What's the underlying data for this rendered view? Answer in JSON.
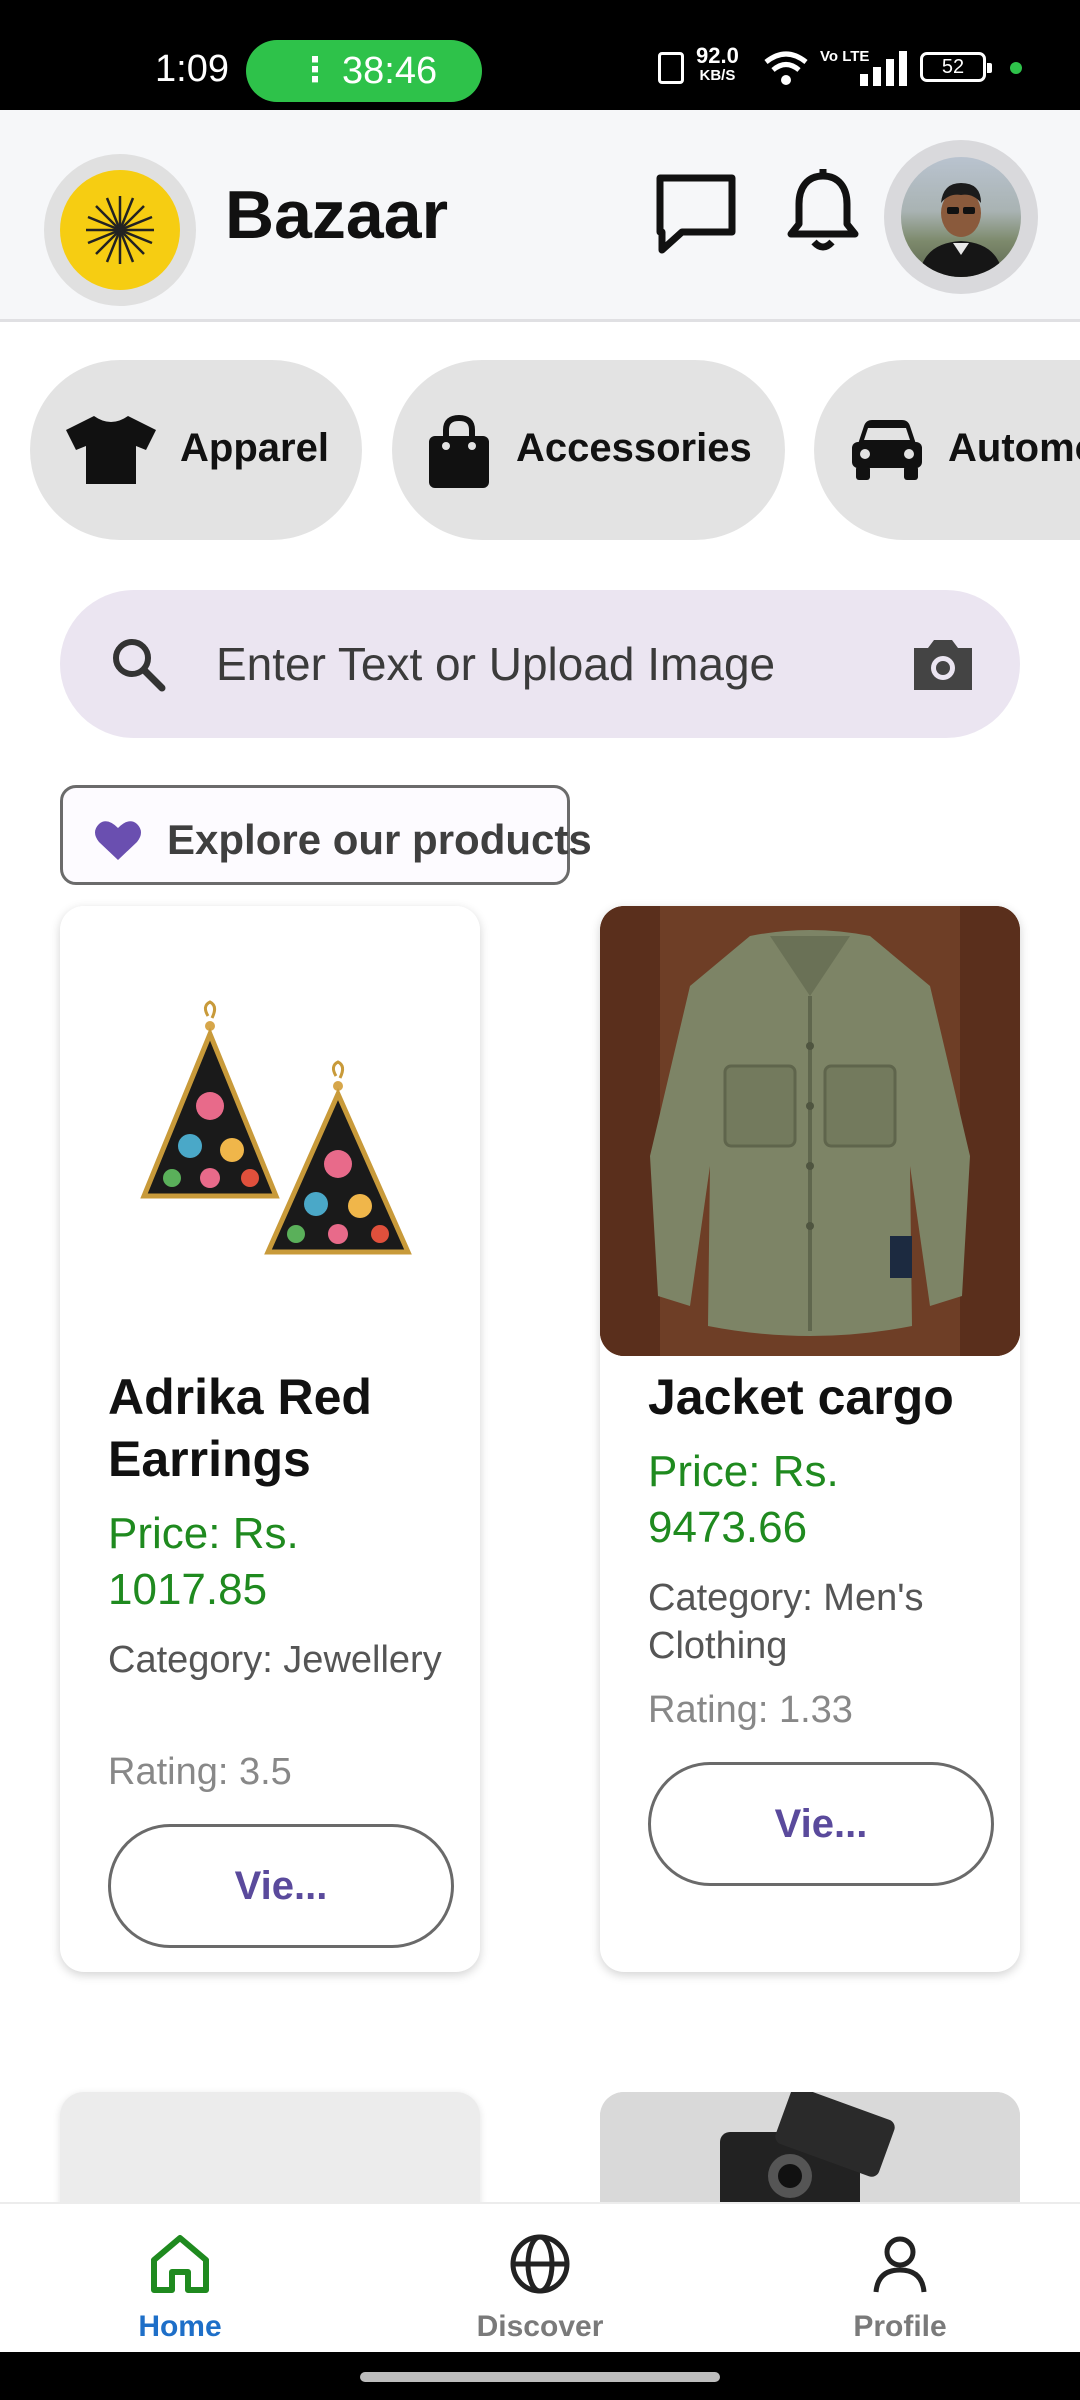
{
  "status_bar": {
    "time": "1:09",
    "call_timer": "38:46",
    "net_speed": "92.0",
    "net_unit": "KB/S",
    "volte": "Vo LTE",
    "battery": "52"
  },
  "header": {
    "title": "Bazaar",
    "chat_icon": "chat-bubble-icon",
    "notification_icon": "bell-icon"
  },
  "categories": [
    {
      "label": "Apparel",
      "icon": "tshirt-icon"
    },
    {
      "label": "Accessories",
      "icon": "shopping-bag-icon"
    },
    {
      "label": "Automo",
      "icon": "car-icon"
    }
  ],
  "search": {
    "placeholder": "Enter Text or Upload Image",
    "value": ""
  },
  "explore": {
    "label": "Explore our products"
  },
  "products": [
    {
      "name": "Adrika Red Earrings",
      "price": "Price: Rs. 1017.85",
      "category": "Category: Jewellery",
      "rating": "Rating: 3.5",
      "button": "Vie..."
    },
    {
      "name": "Jacket cargo",
      "price": "Price: Rs. 9473.66",
      "category": "Category: Men's Clothing",
      "rating": "Rating: 1.33",
      "button": "Vie..."
    }
  ],
  "bottom_nav": [
    {
      "label": "Home",
      "icon": "home-icon",
      "active": true
    },
    {
      "label": "Discover",
      "icon": "globe-icon",
      "active": false
    },
    {
      "label": "Profile",
      "icon": "person-icon",
      "active": false
    }
  ],
  "colors": {
    "accent": "#6a4fb0",
    "price": "#1f8a1f",
    "active_nav_icon": "#1f8a1f",
    "active_nav_label": "#1e6fc8",
    "logo": "#f6cd12"
  }
}
